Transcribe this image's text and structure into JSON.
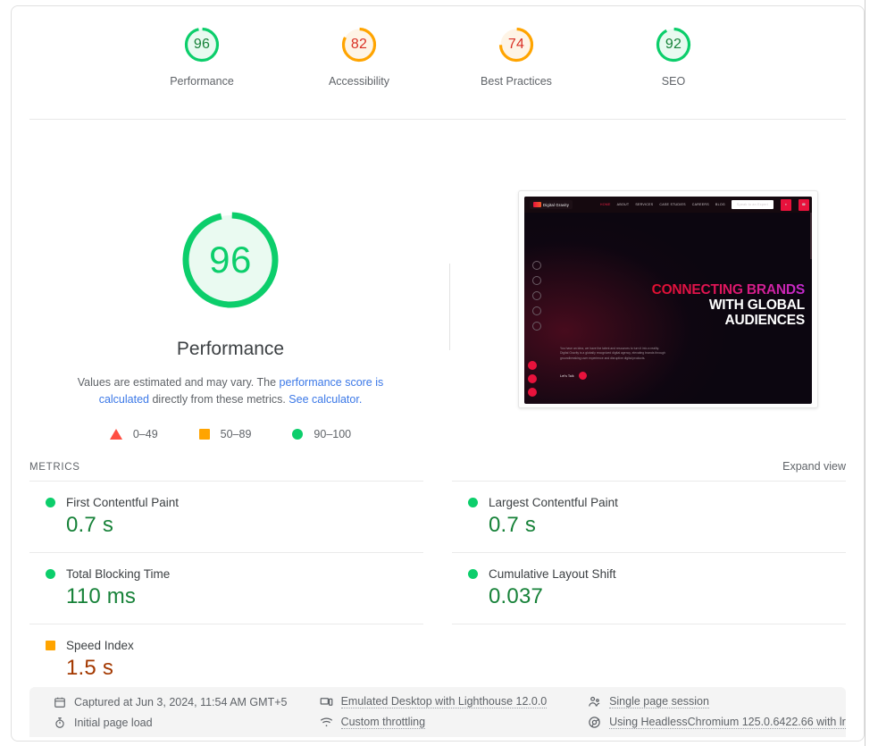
{
  "category_gauges": [
    {
      "score": "96",
      "label": "Performance",
      "band": "pass"
    },
    {
      "score": "82",
      "label": "Accessibility",
      "band": "average"
    },
    {
      "score": "74",
      "label": "Best Practices",
      "band": "average"
    },
    {
      "score": "92",
      "label": "SEO",
      "band": "pass"
    }
  ],
  "hero": {
    "score": "96",
    "title": "Performance",
    "desc_part1": "Values are estimated and may vary. The ",
    "desc_link1": "performance score is calculated",
    "desc_part2": " directly from these metrics. ",
    "desc_link2": "See calculator.",
    "legend": [
      {
        "icon": "triangle-icon",
        "range": "0–49"
      },
      {
        "icon": "square-icon",
        "range": "50–89"
      },
      {
        "icon": "circle-icon",
        "range": "90–100"
      }
    ]
  },
  "thumbnail": {
    "logo_text": "Digital Gravity",
    "nav": [
      "HOME",
      "ABOUT",
      "SERVICES",
      "CASE STUDIES",
      "CAREERS",
      "BLOG"
    ],
    "cta": "Speak to an Expert",
    "headline_line1": "CONNECTING BRANDS",
    "headline_line2": "WITH GLOBAL",
    "headline_line3": "AUDIENCES",
    "paragraph": "You have an idea, we have the talent and resources to turn it into a reality. Digital Gravity is a globally recognized digital agency, elevating brands through groundbreaking user experience and disruptive digital products.",
    "talk_label": "Let's Talk"
  },
  "metrics_section": {
    "title": "METRICS",
    "expand_label": "Expand view",
    "left": [
      {
        "name": "First Contentful Paint",
        "value": "0.7 s",
        "band": "pass"
      },
      {
        "name": "Total Blocking Time",
        "value": "110 ms",
        "band": "pass"
      },
      {
        "name": "Speed Index",
        "value": "1.5 s",
        "band": "average"
      }
    ],
    "right": [
      {
        "name": "Largest Contentful Paint",
        "value": "0.7 s",
        "band": "pass"
      },
      {
        "name": "Cumulative Layout Shift",
        "value": "0.037",
        "band": "pass"
      }
    ]
  },
  "environment": {
    "captured_at": "Captured at Jun 3, 2024, 11:54 AM GMT+5",
    "page_load": "Initial page load",
    "emulation": "Emulated Desktop with Lighthouse 12.0.0",
    "throttling": "Custom throttling",
    "session": "Single page session",
    "user_agent": "Using HeadlessChromium 125.0.6422.66 with lr"
  },
  "colors": {
    "pass": "#0cce6b",
    "average": "#ffa400",
    "fail": "#ff4e42",
    "value_pass": "#178239",
    "value_average": "#a33800",
    "link": "#3b78e7"
  }
}
